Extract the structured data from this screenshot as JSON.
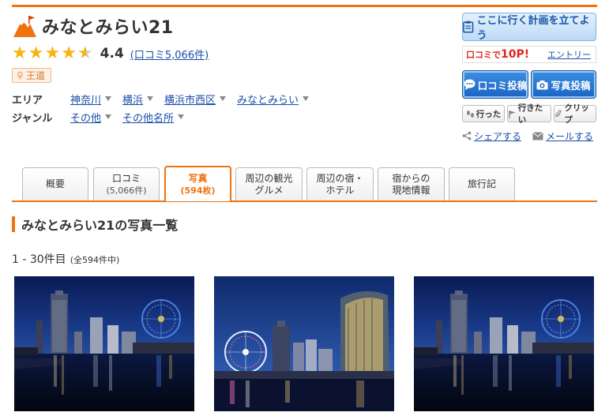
{
  "spot": {
    "title": "みなとみらい21",
    "rating": "4.4",
    "rating_value": 4.4,
    "review_link": "(口コミ5,066件)",
    "badge": "王道",
    "icon": "mountain-icon"
  },
  "meta": {
    "area_label": "エリア",
    "area_items": [
      "神奈川",
      "横浜",
      "横浜市西区",
      "みなとみらい"
    ],
    "genre_label": "ジャンル",
    "genre_items": [
      "その他",
      "その他名所"
    ]
  },
  "actions": {
    "plan_label": "ここに行く計画を立てよう",
    "points_prefix": "口コミで",
    "points_value": "10P!",
    "entry_label": "エントリー",
    "review_post": "口コミ投稿",
    "photo_post": "写真投稿",
    "went": "行った",
    "want": "行きたい",
    "clip": "クリップ",
    "share": "シェアする",
    "mail": "メールする"
  },
  "tabs": [
    {
      "label": "概要",
      "sub": ""
    },
    {
      "label": "口コミ",
      "sub": "(5,066件)"
    },
    {
      "label": "写真",
      "sub": "(594枚)",
      "active": true
    },
    {
      "label": "周辺の観光",
      "sub": "グルメ"
    },
    {
      "label": "周辺の宿・",
      "sub": "ホテル"
    },
    {
      "label": "宿からの",
      "sub": "現地情報"
    },
    {
      "label": "旅行記",
      "sub": ""
    }
  ],
  "section_title": "みなとみらい21の写真一覧",
  "count": {
    "range": "1 - 30件目",
    "total": "(全594件中)"
  },
  "colors": {
    "accent": "#f0730f",
    "link": "#1a4ea8",
    "star": "#f6b40f"
  }
}
